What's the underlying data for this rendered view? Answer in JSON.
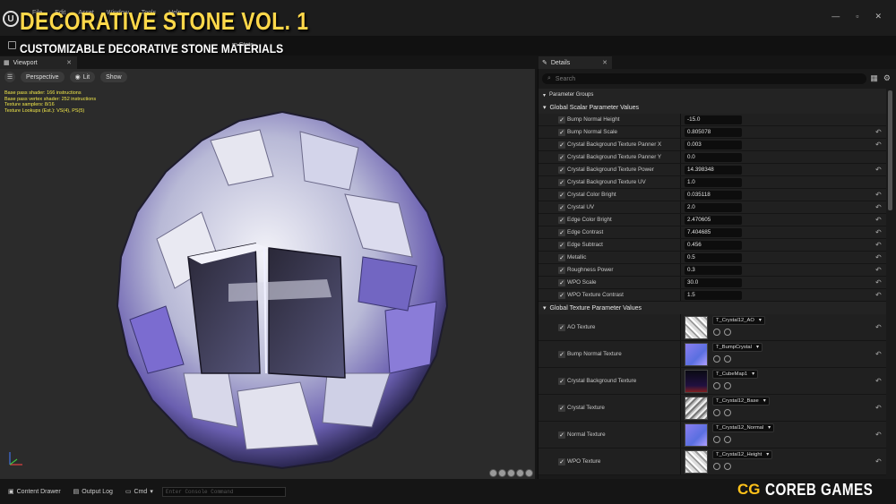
{
  "app": {
    "menu": [
      "File",
      "Edit",
      "Asset",
      "Window",
      "Tools",
      "Help"
    ],
    "window_controls": [
      "—",
      "▫",
      "✕"
    ]
  },
  "overlay": {
    "title": "DECORATIVE STONE VOL. 1",
    "subtitle": "CUSTOMIZABLE DECORATIVE STONE MATERIALS",
    "brand_short": "CG",
    "brand_name": "COREB GAMES"
  },
  "toolbar": {
    "stats_label": "m Stats"
  },
  "viewport": {
    "tab_label": "Viewport",
    "perspective_label": "Perspective",
    "lit_label": "Lit",
    "show_label": "Show",
    "stats_lines": [
      "Base pass shader: 166 instructions",
      "Base pass vertex shader: 252 instructions",
      "Texture samplers: 8/16",
      "Texture Lookups (Est.): VS(4), PS(5)"
    ]
  },
  "details": {
    "tab_label": "Details",
    "search_placeholder": "Search",
    "parameter_groups_label": "Parameter Groups",
    "scalar_group_label": "Global Scalar Parameter Values",
    "texture_group_label": "Global Texture Parameter Values",
    "scalar_params": [
      {
        "label": "Bump Normal Height",
        "value": "-15.0",
        "reset": false
      },
      {
        "label": "Bump Normal Scale",
        "value": "0.805078",
        "reset": true
      },
      {
        "label": "Crystal Background Texture Panner X",
        "value": "0.003",
        "reset": true
      },
      {
        "label": "Crystal Background Texture Panner Y",
        "value": "0.0",
        "reset": false
      },
      {
        "label": "Crystal Background Texture Power",
        "value": "14.398348",
        "reset": true
      },
      {
        "label": "Crystal Background Texture UV",
        "value": "1.0",
        "reset": false
      },
      {
        "label": "Crystal Color Bright",
        "value": "0.035118",
        "reset": true
      },
      {
        "label": "Crystal UV",
        "value": "2.0",
        "reset": true
      },
      {
        "label": "Edge Color Bright",
        "value": "2.470605",
        "reset": true
      },
      {
        "label": "Edge Contrast",
        "value": "7.404685",
        "reset": true
      },
      {
        "label": "Edge Subtract",
        "value": "0.456",
        "reset": true
      },
      {
        "label": "Metallic",
        "value": "0.5",
        "reset": true
      },
      {
        "label": "Roughness Power",
        "value": "0.3",
        "reset": true
      },
      {
        "label": "WPO Scale",
        "value": "30.0",
        "reset": true
      },
      {
        "label": "WPO Texture Contrast",
        "value": "1.5",
        "reset": true
      }
    ],
    "texture_params": [
      {
        "label": "AO Texture",
        "texture": "T_Crystal12_AO",
        "thumb": "ao"
      },
      {
        "label": "Bump Normal Texture",
        "texture": "T_BumpCrystal",
        "thumb": "normal"
      },
      {
        "label": "Crystal Background Texture",
        "texture": "T_CubeMap1",
        "thumb": "cube"
      },
      {
        "label": "Crystal Texture",
        "texture": "T_Crystal12_Base",
        "thumb": "base"
      },
      {
        "label": "Normal Texture",
        "texture": "T_Crystal12_Normal",
        "thumb": "normal"
      },
      {
        "label": "WPO Texture",
        "texture": "T_Crystal12_Height",
        "thumb": "ao"
      }
    ]
  },
  "bottombar": {
    "content_drawer": "Content Drawer",
    "output_log": "Output Log",
    "cmd": "Cmd",
    "console_placeholder": "Enter Console Command"
  },
  "colors": {
    "title_yellow": "#ffd84a",
    "stats_yellow": "#f2e84a",
    "brand_yellow": "#ffc21a",
    "panel_bg": "#1a1a1a",
    "viewport_bg": "#2b2b2b"
  }
}
